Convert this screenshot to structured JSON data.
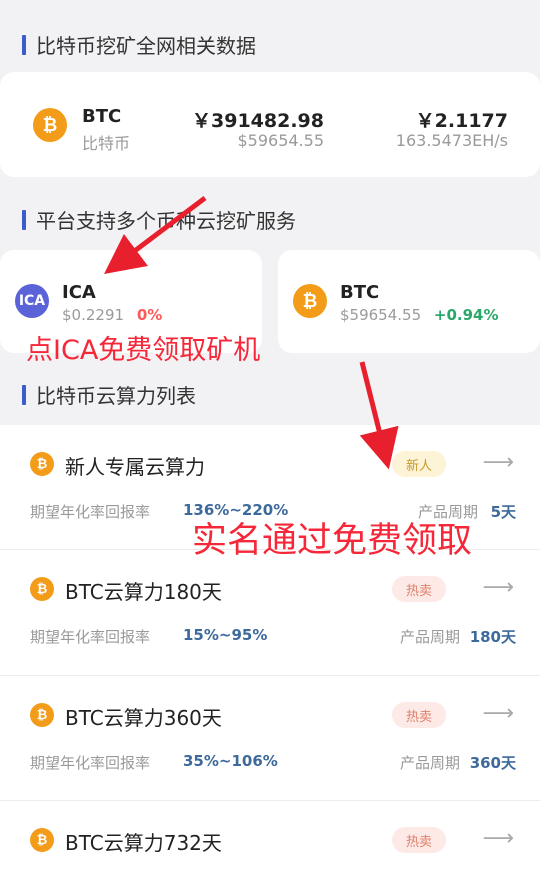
{
  "sections": {
    "network": "比特币挖矿全网相关数据",
    "services": "平台支持多个币种云挖矿服务",
    "hashlist": "比特币云算力列表"
  },
  "network_card": {
    "coin_symbol": "BTC",
    "coin_name": "比特币",
    "price_cny": "￥391482.98",
    "price_usd": "$59654.55",
    "reward": "￥2.1177",
    "hashrate": "163.5473EH/s"
  },
  "coins": [
    {
      "symbol": "ICA",
      "price": "$0.2291",
      "change": "0%"
    },
    {
      "symbol": "BTC",
      "price": "$59654.55",
      "change": "+0.94%"
    }
  ],
  "list_labels": {
    "rate": "期望年化率回报率",
    "period": "产品周期"
  },
  "products": [
    {
      "name": "新人专属云算力",
      "badge": "新人",
      "rate": "136%~220%",
      "period": "5天"
    },
    {
      "name": "BTC云算力180天",
      "badge": "热卖",
      "rate": "15%~95%",
      "period": "180天"
    },
    {
      "name": "BTC云算力360天",
      "badge": "热卖",
      "rate": "35%~106%",
      "period": "360天"
    },
    {
      "name": "BTC云算力732天",
      "badge": "热卖",
      "rate": "",
      "period": ""
    }
  ],
  "annotations": {
    "ica_tip": "点ICA免费领取矿机",
    "verify_tip": "实名通过免费领取"
  },
  "icons": {
    "btc": "bitcoin-icon",
    "ica": "ica-icon",
    "arrow": "arrow-right-icon"
  },
  "colors": {
    "accent": "#3b5ccc",
    "btc": "#f39c1a",
    "annotation": "#f52738",
    "positive": "#2aa86a",
    "zero": "#ff5a5a"
  }
}
